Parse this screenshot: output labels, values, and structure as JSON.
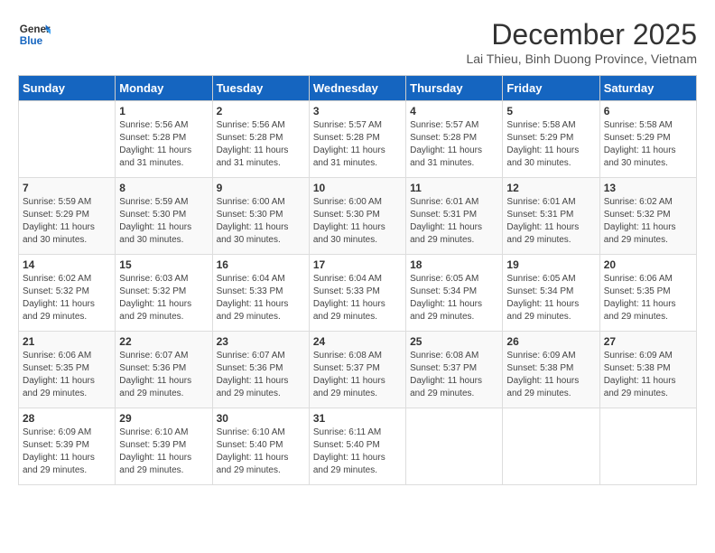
{
  "header": {
    "logo_line1": "General",
    "logo_line2": "Blue",
    "month": "December 2025",
    "location": "Lai Thieu, Binh Duong Province, Vietnam"
  },
  "days_of_week": [
    "Sunday",
    "Monday",
    "Tuesday",
    "Wednesday",
    "Thursday",
    "Friday",
    "Saturday"
  ],
  "weeks": [
    [
      {
        "day": "",
        "info": ""
      },
      {
        "day": "1",
        "info": "Sunrise: 5:56 AM\nSunset: 5:28 PM\nDaylight: 11 hours\nand 31 minutes."
      },
      {
        "day": "2",
        "info": "Sunrise: 5:56 AM\nSunset: 5:28 PM\nDaylight: 11 hours\nand 31 minutes."
      },
      {
        "day": "3",
        "info": "Sunrise: 5:57 AM\nSunset: 5:28 PM\nDaylight: 11 hours\nand 31 minutes."
      },
      {
        "day": "4",
        "info": "Sunrise: 5:57 AM\nSunset: 5:28 PM\nDaylight: 11 hours\nand 31 minutes."
      },
      {
        "day": "5",
        "info": "Sunrise: 5:58 AM\nSunset: 5:29 PM\nDaylight: 11 hours\nand 30 minutes."
      },
      {
        "day": "6",
        "info": "Sunrise: 5:58 AM\nSunset: 5:29 PM\nDaylight: 11 hours\nand 30 minutes."
      }
    ],
    [
      {
        "day": "7",
        "info": "Sunrise: 5:59 AM\nSunset: 5:29 PM\nDaylight: 11 hours\nand 30 minutes."
      },
      {
        "day": "8",
        "info": "Sunrise: 5:59 AM\nSunset: 5:30 PM\nDaylight: 11 hours\nand 30 minutes."
      },
      {
        "day": "9",
        "info": "Sunrise: 6:00 AM\nSunset: 5:30 PM\nDaylight: 11 hours\nand 30 minutes."
      },
      {
        "day": "10",
        "info": "Sunrise: 6:00 AM\nSunset: 5:30 PM\nDaylight: 11 hours\nand 30 minutes."
      },
      {
        "day": "11",
        "info": "Sunrise: 6:01 AM\nSunset: 5:31 PM\nDaylight: 11 hours\nand 29 minutes."
      },
      {
        "day": "12",
        "info": "Sunrise: 6:01 AM\nSunset: 5:31 PM\nDaylight: 11 hours\nand 29 minutes."
      },
      {
        "day": "13",
        "info": "Sunrise: 6:02 AM\nSunset: 5:32 PM\nDaylight: 11 hours\nand 29 minutes."
      }
    ],
    [
      {
        "day": "14",
        "info": "Sunrise: 6:02 AM\nSunset: 5:32 PM\nDaylight: 11 hours\nand 29 minutes."
      },
      {
        "day": "15",
        "info": "Sunrise: 6:03 AM\nSunset: 5:32 PM\nDaylight: 11 hours\nand 29 minutes."
      },
      {
        "day": "16",
        "info": "Sunrise: 6:04 AM\nSunset: 5:33 PM\nDaylight: 11 hours\nand 29 minutes."
      },
      {
        "day": "17",
        "info": "Sunrise: 6:04 AM\nSunset: 5:33 PM\nDaylight: 11 hours\nand 29 minutes."
      },
      {
        "day": "18",
        "info": "Sunrise: 6:05 AM\nSunset: 5:34 PM\nDaylight: 11 hours\nand 29 minutes."
      },
      {
        "day": "19",
        "info": "Sunrise: 6:05 AM\nSunset: 5:34 PM\nDaylight: 11 hours\nand 29 minutes."
      },
      {
        "day": "20",
        "info": "Sunrise: 6:06 AM\nSunset: 5:35 PM\nDaylight: 11 hours\nand 29 minutes."
      }
    ],
    [
      {
        "day": "21",
        "info": "Sunrise: 6:06 AM\nSunset: 5:35 PM\nDaylight: 11 hours\nand 29 minutes."
      },
      {
        "day": "22",
        "info": "Sunrise: 6:07 AM\nSunset: 5:36 PM\nDaylight: 11 hours\nand 29 minutes."
      },
      {
        "day": "23",
        "info": "Sunrise: 6:07 AM\nSunset: 5:36 PM\nDaylight: 11 hours\nand 29 minutes."
      },
      {
        "day": "24",
        "info": "Sunrise: 6:08 AM\nSunset: 5:37 PM\nDaylight: 11 hours\nand 29 minutes."
      },
      {
        "day": "25",
        "info": "Sunrise: 6:08 AM\nSunset: 5:37 PM\nDaylight: 11 hours\nand 29 minutes."
      },
      {
        "day": "26",
        "info": "Sunrise: 6:09 AM\nSunset: 5:38 PM\nDaylight: 11 hours\nand 29 minutes."
      },
      {
        "day": "27",
        "info": "Sunrise: 6:09 AM\nSunset: 5:38 PM\nDaylight: 11 hours\nand 29 minutes."
      }
    ],
    [
      {
        "day": "28",
        "info": "Sunrise: 6:09 AM\nSunset: 5:39 PM\nDaylight: 11 hours\nand 29 minutes."
      },
      {
        "day": "29",
        "info": "Sunrise: 6:10 AM\nSunset: 5:39 PM\nDaylight: 11 hours\nand 29 minutes."
      },
      {
        "day": "30",
        "info": "Sunrise: 6:10 AM\nSunset: 5:40 PM\nDaylight: 11 hours\nand 29 minutes."
      },
      {
        "day": "31",
        "info": "Sunrise: 6:11 AM\nSunset: 5:40 PM\nDaylight: 11 hours\nand 29 minutes."
      },
      {
        "day": "",
        "info": ""
      },
      {
        "day": "",
        "info": ""
      },
      {
        "day": "",
        "info": ""
      }
    ]
  ]
}
